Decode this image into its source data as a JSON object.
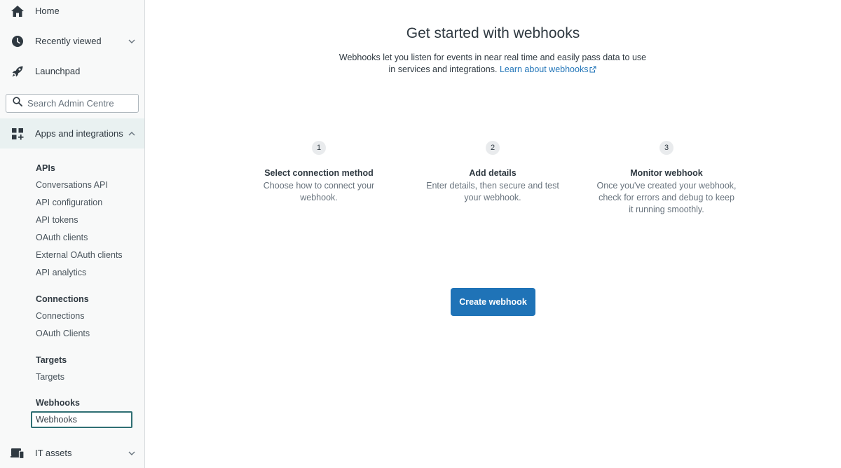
{
  "sidebar": {
    "home_label": "Home",
    "recently_viewed_label": "Recently viewed",
    "launchpad_label": "Launchpad",
    "search_placeholder": "Search Admin Centre",
    "apps_label": "Apps and integrations",
    "it_assets_label": "IT assets",
    "sections": {
      "apis": {
        "heading": "APIs",
        "links": [
          "Conversations API",
          "API configuration",
          "API tokens",
          "OAuth clients",
          "External OAuth clients",
          "API analytics"
        ]
      },
      "connections": {
        "heading": "Connections",
        "links": [
          "Connections",
          "OAuth Clients"
        ]
      },
      "targets": {
        "heading": "Targets",
        "links": [
          "Targets"
        ]
      },
      "webhooks": {
        "heading": "Webhooks",
        "links": [
          "Webhooks"
        ]
      }
    }
  },
  "main": {
    "title": "Get started with webhooks",
    "description": "Webhooks let you listen for events in near real time and easily pass data to use in services and integrations.",
    "learn_link": "Learn about webhooks",
    "steps": [
      {
        "number": "1",
        "title": "Select connection method",
        "text": "Choose how to connect your webhook."
      },
      {
        "number": "2",
        "title": "Add details",
        "text": "Enter details, then secure and test your webhook."
      },
      {
        "number": "3",
        "title": "Monitor webhook",
        "text": "Once you've created your webhook, check for errors and debug to keep it running smoothly."
      }
    ],
    "create_button": "Create webhook"
  },
  "colors": {
    "accent": "#1f73b7",
    "sidebar_bg": "#f8f9f9",
    "active_bg": "#e9f1f1"
  },
  "icons": {
    "home": "home-icon",
    "recently_viewed": "clock-icon",
    "launchpad": "rocket-icon",
    "search": "search-icon",
    "apps": "apps-grid-icon",
    "it_assets": "devices-icon",
    "chevron": "chevron-icon",
    "external": "external-link-icon"
  }
}
